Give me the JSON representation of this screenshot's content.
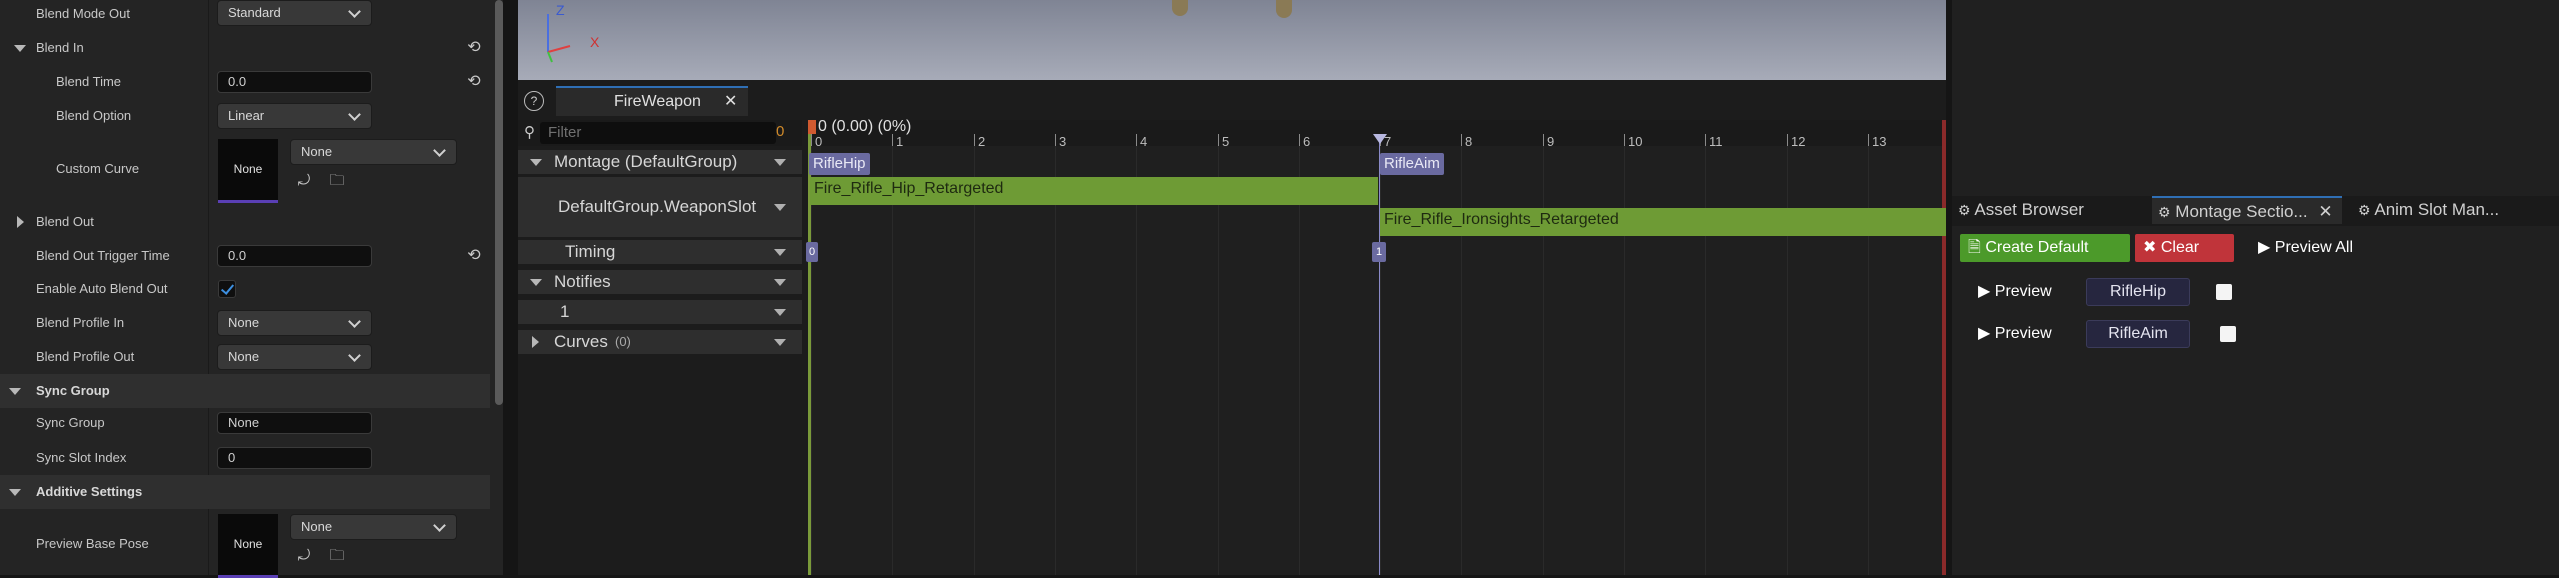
{
  "details": {
    "blend_mode_out": {
      "label": "Blend Mode Out",
      "value": "Standard"
    },
    "blend_in": {
      "label": "Blend In",
      "blend_time": {
        "label": "Blend Time",
        "value": "0.0"
      },
      "blend_option": {
        "label": "Blend Option",
        "value": "Linear"
      },
      "custom_curve": {
        "label": "Custom Curve",
        "thumb": "None",
        "value": "None"
      }
    },
    "blend_out": {
      "label": "Blend Out"
    },
    "blend_out_trigger_time": {
      "label": "Blend Out Trigger Time",
      "value": "0.0"
    },
    "enable_auto_blend_out": {
      "label": "Enable Auto Blend Out",
      "checked": true
    },
    "blend_profile_in": {
      "label": "Blend Profile In",
      "value": "None"
    },
    "blend_profile_out": {
      "label": "Blend Profile Out",
      "value": "None"
    },
    "sync_group_category": "Sync Group",
    "sync_group": {
      "label": "Sync Group",
      "value": "None"
    },
    "sync_slot_index": {
      "label": "Sync Slot Index",
      "value": "0"
    },
    "additive_category": "Additive Settings",
    "preview_base_pose": {
      "label": "Preview Base Pose",
      "thumb": "None",
      "value": "None"
    }
  },
  "viewport": {
    "axis_z": "Z",
    "axis_x": "X"
  },
  "montage": {
    "tab_title": "FireWeapon",
    "filter_placeholder": "Filter",
    "filter_count": "0",
    "time_readout": "0 (0.00) (0%)",
    "ruler_labels": [
      "0",
      "1",
      "2",
      "3",
      "4",
      "5",
      "6",
      "7",
      "8",
      "9",
      "10",
      "11",
      "12",
      "13"
    ],
    "tracks": {
      "montage_group": "Montage (DefaultGroup)",
      "slot": "DefaultGroup.WeaponSlot",
      "timing": "Timing",
      "notifies": "Notifies",
      "notify_track": "1",
      "curves": "Curves",
      "curves_count": "(0)"
    },
    "sections": [
      "RifleHip",
      "RifleAim"
    ],
    "segments": [
      "Fire_Rifle_Hip_Retargeted",
      "Fire_Rifle_Ironsights_Retargeted"
    ],
    "timing_markers": [
      "0",
      "1"
    ]
  },
  "right_panel": {
    "tabs": [
      "Asset Browser",
      "Montage Sectio...",
      "Anim Slot Man..."
    ],
    "create_default": "Create Default",
    "clear": "Clear",
    "preview_all": "Preview All",
    "rows": [
      {
        "preview": "Preview",
        "section": "RifleHip"
      },
      {
        "preview": "Preview",
        "section": "RifleAim"
      }
    ]
  },
  "colors": {
    "section": "#6a6aa0",
    "segment": "#6e9b35",
    "create_default": "#4c9a2a",
    "clear": "#c0343a"
  }
}
